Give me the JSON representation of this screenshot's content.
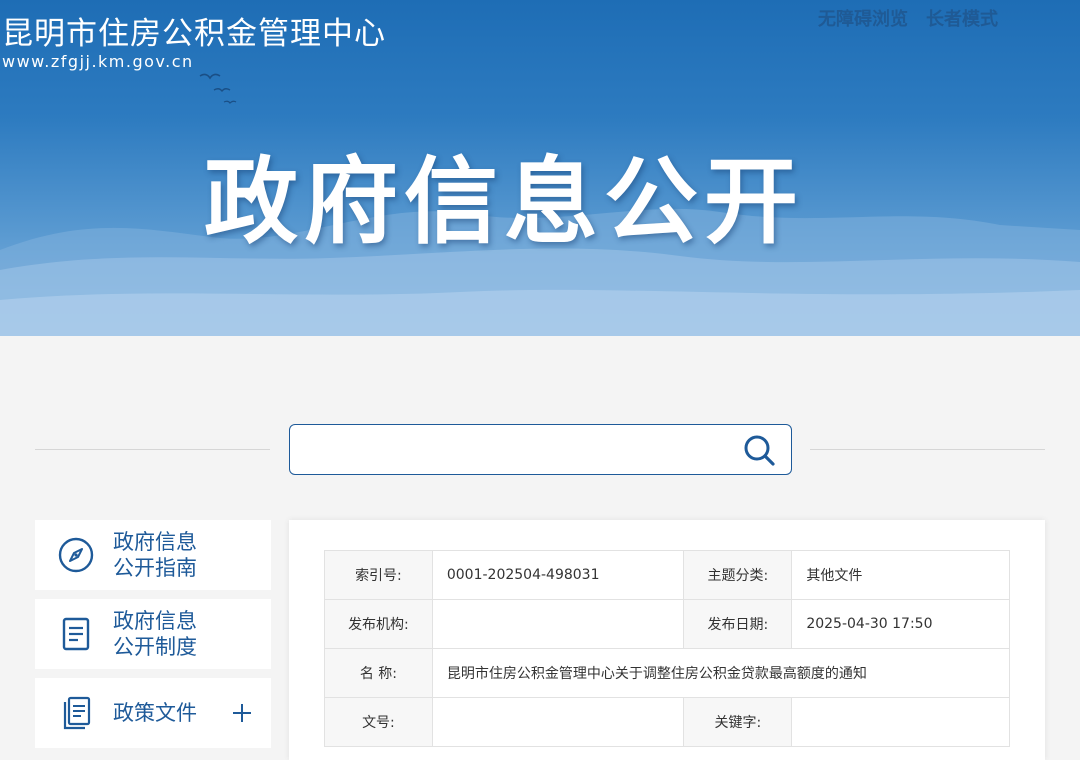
{
  "header": {
    "site_name": "昆明市住房公积金管理中心",
    "site_url": "www.zfgjj.km.gov.cn",
    "links": [
      "无障碍浏览",
      "长者模式"
    ],
    "banner_title": "政府信息公开"
  },
  "search": {
    "value": "",
    "icon": "search-icon"
  },
  "sidebar": {
    "items": [
      {
        "label_line1": "政府信息",
        "label_line2": "公开指南",
        "icon": "compass-icon"
      },
      {
        "label_line1": "政府信息",
        "label_line2": "公开制度",
        "icon": "document-icon"
      },
      {
        "label_line1": "政策文件",
        "label_line2": "",
        "icon": "documents-icon",
        "expand_icon": "plus-icon"
      }
    ]
  },
  "meta_table": {
    "rows": [
      {
        "k1": "索引号:",
        "v1": "0001-202504-498031",
        "k2": "主题分类:",
        "v2": "其他文件"
      },
      {
        "k1": "发布机构:",
        "v1": "",
        "k2": "发布日期:",
        "v2": "2025-04-30 17:50"
      },
      {
        "k1": "名 称:",
        "v1": "昆明市住房公积金管理中心关于调整住房公积金贷款最高额度的通知"
      },
      {
        "k1": "文号:",
        "v1": "",
        "k2": "关键字:",
        "v2": ""
      }
    ]
  },
  "colors": {
    "primary": "#1e5a99",
    "banner_top": "#1e6db5",
    "background": "#f4f4f4"
  }
}
